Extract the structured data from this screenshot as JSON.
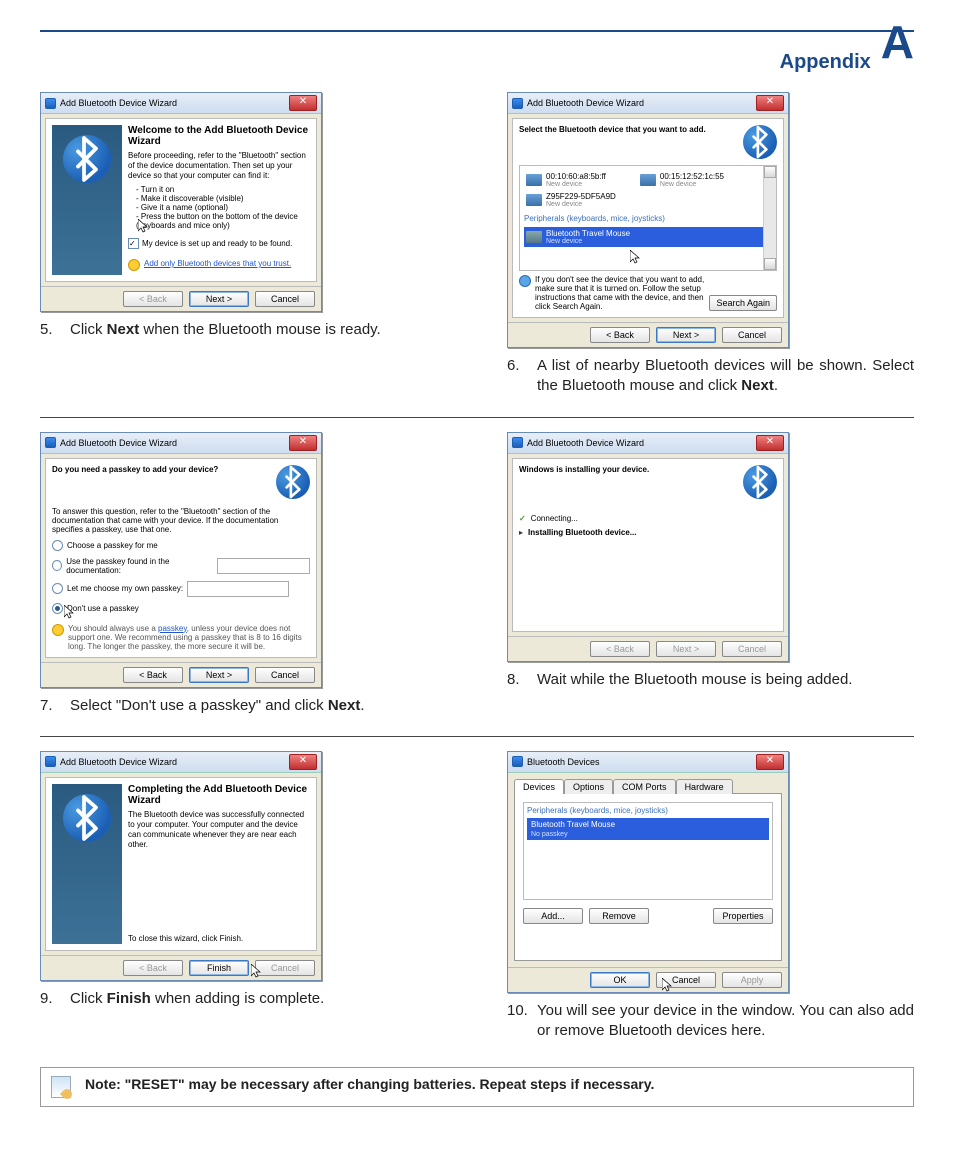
{
  "header": {
    "title": "Appendix",
    "letter": "A"
  },
  "wizardTitle": "Add Bluetooth Device Wizard",
  "bdTitle": "Bluetooth Devices",
  "buttons": {
    "back": "< Back",
    "next": "Next >",
    "cancel": "Cancel",
    "finish": "Finish",
    "searchAgain": "Search Again",
    "add": "Add...",
    "remove": "Remove",
    "properties": "Properties",
    "ok": "OK",
    "apply": "Apply"
  },
  "step5": {
    "num": "5.",
    "text_pre": "Click ",
    "bold": "Next",
    "text_post": " when the Bluetooth mouse is ready.",
    "heading": "Welcome to the Add Bluetooth Device Wizard",
    "intro": "Before proceeding, refer to the \"Bluetooth\" section of the device documentation. Then set up your device so that your computer can find it:",
    "bullets": [
      "Turn it on",
      "Make it discoverable (visible)",
      "Give it a name (optional)",
      "Press the button on the bottom of the device (keyboards and mice only)"
    ],
    "checkbox": "My device is set up and ready to be found.",
    "warnText": "Add only Bluetooth devices that you trust."
  },
  "step6": {
    "num": "6.",
    "text_pre": "A list of nearby Bluetooth devices will be shown. Select the Bluetooth mouse and click ",
    "bold": "Next",
    "text_post": ".",
    "instr": "Select the Bluetooth device that you want to add.",
    "dev1": {
      "name": "00:10:60:a8:5b:ff",
      "sub": "New device"
    },
    "dev2": {
      "name": "00:15:12:52:1c:55",
      "sub": "New device"
    },
    "dev3": {
      "name": "Z95F229-5DF5A9D",
      "sub": "New device"
    },
    "category": "Peripherals (keyboards, mice, joysticks)",
    "dev4": {
      "name": "Bluetooth Travel Mouse",
      "sub": "New device"
    },
    "hint": "If you don't see the device that you want to add, make sure that it is turned on. Follow the setup instructions that came with the device, and then click Search Again."
  },
  "step7": {
    "num": "7.",
    "text": "Select \"Don't use a passkey\" and click ",
    "bold": "Next",
    "text_post": ".",
    "q": "Do you need a passkey to add your device?",
    "hint": "To answer this question, refer to the \"Bluetooth\" section of the documentation that came with your device. If the documentation specifies a passkey, use that one.",
    "opt1": "Choose a passkey for me",
    "opt2": "Use the passkey found in the documentation:",
    "opt3": "Let me choose my own passkey:",
    "opt4": "Don't use a passkey",
    "warn": "You should always use a passkey, unless your device does not support one. We recommend using a passkey that is 8 to 16 digits long. The longer the passkey, the more secure it will be."
  },
  "step8": {
    "num": "8.",
    "text": "Wait while the Bluetooth mouse is being added.",
    "status1": "Windows is installing your device.",
    "conn": "Connecting...",
    "inst": "Installing Bluetooth device..."
  },
  "step9": {
    "num": "9.",
    "text_pre": "Click ",
    "bold": "Finish",
    "text_post": " when adding is complete.",
    "heading": "Completing the Add Bluetooth Device Wizard",
    "body": "The Bluetooth device was successfully connected to your computer. Your computer and the device can communicate whenever they are near each other.",
    "close": "To close this wizard, click Finish."
  },
  "step10": {
    "num": "10.",
    "text": "You will see your device in the window. You can also add or remove Bluetooth devices here.",
    "tabs": [
      "Devices",
      "Options",
      "COM Ports",
      "Hardware"
    ],
    "category": "Peripherals (keyboards, mice, joysticks)",
    "device": "Bluetooth Travel Mouse",
    "deviceSub": "No passkey"
  },
  "note": "Note: \"RESET\" may be necessary after changing batteries. Repeat steps if necessary."
}
